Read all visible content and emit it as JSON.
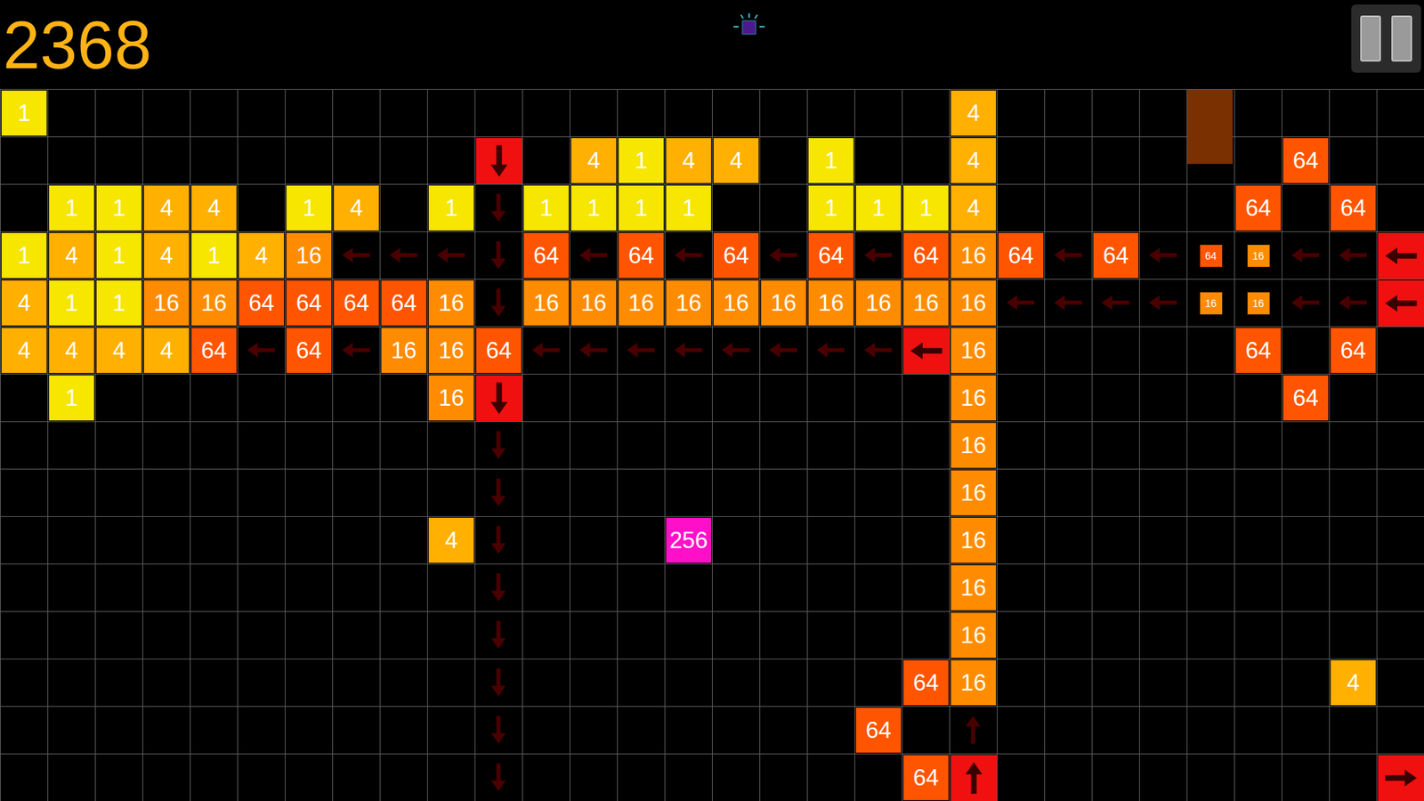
{
  "score": "2368",
  "board": {
    "columns": 30,
    "rows": [
      {
        "cells": [
          {
            "col": 0,
            "kind": "tile",
            "text": "1",
            "color": "#f7e600"
          },
          {
            "col": 20,
            "kind": "tile",
            "text": "4",
            "color": "#ffb000"
          },
          {
            "col": 25,
            "kind": "ghost",
            "color": "#7a3000"
          }
        ]
      },
      {
        "cells": [
          {
            "col": 10,
            "kind": "launcher",
            "direction": "down",
            "color": "#f01010"
          },
          {
            "col": 12,
            "kind": "tile",
            "text": "4",
            "color": "#ffb000"
          },
          {
            "col": 13,
            "kind": "tile",
            "text": "1",
            "color": "#f7e600"
          },
          {
            "col": 14,
            "kind": "tile",
            "text": "4",
            "color": "#ffb000"
          },
          {
            "col": 15,
            "kind": "tile",
            "text": "4",
            "color": "#ffb000"
          },
          {
            "col": 17,
            "kind": "tile",
            "text": "1",
            "color": "#f7e600"
          },
          {
            "col": 20,
            "kind": "tile",
            "text": "4",
            "color": "#ffb000"
          },
          {
            "col": 27,
            "kind": "tile",
            "text": "64",
            "color": "#ff5500"
          }
        ]
      },
      {
        "cells": [
          {
            "col": 1,
            "kind": "tile",
            "text": "1",
            "color": "#f7e600"
          },
          {
            "col": 2,
            "kind": "tile",
            "text": "1",
            "color": "#f7e600"
          },
          {
            "col": 3,
            "kind": "tile",
            "text": "4",
            "color": "#ffb000"
          },
          {
            "col": 4,
            "kind": "tile",
            "text": "4",
            "color": "#ffb000"
          },
          {
            "col": 6,
            "kind": "tile",
            "text": "1",
            "color": "#f7e600"
          },
          {
            "col": 7,
            "kind": "tile",
            "text": "4",
            "color": "#ffb000"
          },
          {
            "col": 9,
            "kind": "tile",
            "text": "1",
            "color": "#f7e600"
          },
          {
            "col": 10,
            "kind": "arrow",
            "direction": "down"
          },
          {
            "col": 11,
            "kind": "tile",
            "text": "1",
            "color": "#f7e600"
          },
          {
            "col": 12,
            "kind": "tile",
            "text": "1",
            "color": "#f7e600"
          },
          {
            "col": 13,
            "kind": "tile",
            "text": "1",
            "color": "#f7e600"
          },
          {
            "col": 14,
            "kind": "tile",
            "text": "1",
            "color": "#f7e600"
          },
          {
            "col": 17,
            "kind": "tile",
            "text": "1",
            "color": "#f7e600"
          },
          {
            "col": 18,
            "kind": "tile",
            "text": "1",
            "color": "#f7e600"
          },
          {
            "col": 19,
            "kind": "tile",
            "text": "1",
            "color": "#f7e600"
          },
          {
            "col": 20,
            "kind": "tile",
            "text": "4",
            "color": "#ffb000"
          },
          {
            "col": 26,
            "kind": "tile",
            "text": "64",
            "color": "#ff5500"
          },
          {
            "col": 28,
            "kind": "tile",
            "text": "64",
            "color": "#ff5500"
          }
        ]
      },
      {
        "cells": [
          {
            "col": 0,
            "kind": "tile",
            "text": "1",
            "color": "#f7e600"
          },
          {
            "col": 1,
            "kind": "tile",
            "text": "4",
            "color": "#ffb000"
          },
          {
            "col": 2,
            "kind": "tile",
            "text": "1",
            "color": "#f7e600"
          },
          {
            "col": 3,
            "kind": "tile",
            "text": "4",
            "color": "#ffb000"
          },
          {
            "col": 4,
            "kind": "tile",
            "text": "1",
            "color": "#f7e600"
          },
          {
            "col": 5,
            "kind": "tile",
            "text": "4",
            "color": "#ffb000"
          },
          {
            "col": 6,
            "kind": "tile",
            "text": "16",
            "color": "#ff8c00"
          },
          {
            "col": 7,
            "kind": "arrow",
            "direction": "left"
          },
          {
            "col": 8,
            "kind": "arrow",
            "direction": "left"
          },
          {
            "col": 9,
            "kind": "arrow",
            "direction": "left"
          },
          {
            "col": 10,
            "kind": "arrow",
            "direction": "down"
          },
          {
            "col": 11,
            "kind": "tile",
            "text": "64",
            "color": "#ff5500"
          },
          {
            "col": 12,
            "kind": "arrow",
            "direction": "left"
          },
          {
            "col": 13,
            "kind": "tile",
            "text": "64",
            "color": "#ff5500"
          },
          {
            "col": 14,
            "kind": "arrow",
            "direction": "left"
          },
          {
            "col": 15,
            "kind": "tile",
            "text": "64",
            "color": "#ff5500"
          },
          {
            "col": 16,
            "kind": "arrow",
            "direction": "left"
          },
          {
            "col": 17,
            "kind": "tile",
            "text": "64",
            "color": "#ff5500"
          },
          {
            "col": 18,
            "kind": "arrow",
            "direction": "left"
          },
          {
            "col": 19,
            "kind": "tile",
            "text": "64",
            "color": "#ff5500"
          },
          {
            "col": 20,
            "kind": "tile",
            "text": "16",
            "color": "#ff8c00"
          },
          {
            "col": 21,
            "kind": "tile",
            "text": "64",
            "color": "#ff5500"
          },
          {
            "col": 22,
            "kind": "arrow",
            "direction": "left"
          },
          {
            "col": 23,
            "kind": "tile",
            "text": "64",
            "color": "#ff5500"
          },
          {
            "col": 24,
            "kind": "arrow",
            "direction": "left"
          },
          {
            "col": 25,
            "kind": "small",
            "text": "64",
            "color": "#ff5500"
          },
          {
            "col": 26,
            "kind": "small",
            "text": "16",
            "color": "#ff8c00"
          },
          {
            "col": 27,
            "kind": "arrow",
            "direction": "left"
          },
          {
            "col": 28,
            "kind": "arrow",
            "direction": "left"
          },
          {
            "col": 29,
            "kind": "launcher",
            "direction": "left",
            "color": "#f01010"
          }
        ]
      },
      {
        "cells": [
          {
            "col": 0,
            "kind": "tile",
            "text": "4",
            "color": "#ffb000"
          },
          {
            "col": 1,
            "kind": "tile",
            "text": "1",
            "color": "#f7e600"
          },
          {
            "col": 2,
            "kind": "tile",
            "text": "1",
            "color": "#f7e600"
          },
          {
            "col": 3,
            "kind": "tile",
            "text": "16",
            "color": "#ff8c00"
          },
          {
            "col": 4,
            "kind": "tile",
            "text": "16",
            "color": "#ff8c00"
          },
          {
            "col": 5,
            "kind": "tile",
            "text": "64",
            "color": "#ff5500"
          },
          {
            "col": 6,
            "kind": "tile",
            "text": "64",
            "color": "#ff5500"
          },
          {
            "col": 7,
            "kind": "tile",
            "text": "64",
            "color": "#ff5500"
          },
          {
            "col": 8,
            "kind": "tile",
            "text": "64",
            "color": "#ff5500"
          },
          {
            "col": 9,
            "kind": "tile",
            "text": "16",
            "color": "#ff8c00"
          },
          {
            "col": 10,
            "kind": "arrow",
            "direction": "down"
          },
          {
            "col": 11,
            "kind": "tile",
            "text": "16",
            "color": "#ff8c00"
          },
          {
            "col": 12,
            "kind": "tile",
            "text": "16",
            "color": "#ff8c00"
          },
          {
            "col": 13,
            "kind": "tile",
            "text": "16",
            "color": "#ff8c00"
          },
          {
            "col": 14,
            "kind": "tile",
            "text": "16",
            "color": "#ff8c00"
          },
          {
            "col": 15,
            "kind": "tile",
            "text": "16",
            "color": "#ff8c00"
          },
          {
            "col": 16,
            "kind": "tile",
            "text": "16",
            "color": "#ff8c00"
          },
          {
            "col": 17,
            "kind": "tile",
            "text": "16",
            "color": "#ff8c00"
          },
          {
            "col": 18,
            "kind": "tile",
            "text": "16",
            "color": "#ff8c00"
          },
          {
            "col": 19,
            "kind": "tile",
            "text": "16",
            "color": "#ff8c00"
          },
          {
            "col": 20,
            "kind": "tile",
            "text": "16",
            "color": "#ff8c00"
          },
          {
            "col": 21,
            "kind": "arrow",
            "direction": "left"
          },
          {
            "col": 22,
            "kind": "arrow",
            "direction": "left"
          },
          {
            "col": 23,
            "kind": "arrow",
            "direction": "left"
          },
          {
            "col": 24,
            "kind": "arrow",
            "direction": "left"
          },
          {
            "col": 25,
            "kind": "small",
            "text": "16",
            "color": "#ff8c00"
          },
          {
            "col": 26,
            "kind": "small",
            "text": "16",
            "color": "#ff8c00"
          },
          {
            "col": 27,
            "kind": "arrow",
            "direction": "left"
          },
          {
            "col": 28,
            "kind": "arrow",
            "direction": "left"
          },
          {
            "col": 29,
            "kind": "launcher",
            "direction": "left",
            "color": "#f01010"
          }
        ]
      },
      {
        "cells": [
          {
            "col": 0,
            "kind": "tile",
            "text": "4",
            "color": "#ffb000"
          },
          {
            "col": 1,
            "kind": "tile",
            "text": "4",
            "color": "#ffb000"
          },
          {
            "col": 2,
            "kind": "tile",
            "text": "4",
            "color": "#ffb000"
          },
          {
            "col": 3,
            "kind": "tile",
            "text": "4",
            "color": "#ffb000"
          },
          {
            "col": 4,
            "kind": "tile",
            "text": "64",
            "color": "#ff5500"
          },
          {
            "col": 5,
            "kind": "arrow",
            "direction": "left"
          },
          {
            "col": 6,
            "kind": "tile",
            "text": "64",
            "color": "#ff5500"
          },
          {
            "col": 7,
            "kind": "arrow",
            "direction": "left"
          },
          {
            "col": 8,
            "kind": "tile",
            "text": "16",
            "color": "#ff8c00"
          },
          {
            "col": 9,
            "kind": "tile",
            "text": "16",
            "color": "#ff8c00"
          },
          {
            "col": 10,
            "kind": "tile",
            "text": "64",
            "color": "#ff5500"
          },
          {
            "col": 11,
            "kind": "arrow",
            "direction": "left"
          },
          {
            "col": 12,
            "kind": "arrow",
            "direction": "left"
          },
          {
            "col": 13,
            "kind": "arrow",
            "direction": "left"
          },
          {
            "col": 14,
            "kind": "arrow",
            "direction": "left"
          },
          {
            "col": 15,
            "kind": "arrow",
            "direction": "left"
          },
          {
            "col": 16,
            "kind": "arrow",
            "direction": "left"
          },
          {
            "col": 17,
            "kind": "arrow",
            "direction": "left"
          },
          {
            "col": 18,
            "kind": "arrow",
            "direction": "left"
          },
          {
            "col": 19,
            "kind": "launcher",
            "direction": "left",
            "color": "#f01010"
          },
          {
            "col": 20,
            "kind": "tile",
            "text": "16",
            "color": "#ff8c00"
          },
          {
            "col": 26,
            "kind": "tile",
            "text": "64",
            "color": "#ff5500"
          },
          {
            "col": 28,
            "kind": "tile",
            "text": "64",
            "color": "#ff5500"
          }
        ]
      },
      {
        "cells": [
          {
            "col": 1,
            "kind": "tile",
            "text": "1",
            "color": "#f7e600"
          },
          {
            "col": 9,
            "kind": "tile",
            "text": "16",
            "color": "#ff8c00"
          },
          {
            "col": 10,
            "kind": "launcher",
            "direction": "down",
            "color": "#f01010"
          },
          {
            "col": 20,
            "kind": "tile",
            "text": "16",
            "color": "#ff8c00"
          },
          {
            "col": 27,
            "kind": "tile",
            "text": "64",
            "color": "#ff5500"
          }
        ]
      },
      {
        "cells": [
          {
            "col": 10,
            "kind": "arrow",
            "direction": "down"
          },
          {
            "col": 20,
            "kind": "tile",
            "text": "16",
            "color": "#ff8c00"
          }
        ]
      },
      {
        "cells": [
          {
            "col": 10,
            "kind": "arrow",
            "direction": "down"
          },
          {
            "col": 20,
            "kind": "tile",
            "text": "16",
            "color": "#ff8c00"
          }
        ]
      },
      {
        "cells": [
          {
            "col": 9,
            "kind": "tile",
            "text": "4",
            "color": "#ffb000"
          },
          {
            "col": 10,
            "kind": "arrow",
            "direction": "down"
          },
          {
            "col": 14,
            "kind": "tile",
            "text": "256",
            "color": "#ff10c8"
          },
          {
            "col": 20,
            "kind": "tile",
            "text": "16",
            "color": "#ff8c00"
          }
        ]
      },
      {
        "cells": [
          {
            "col": 10,
            "kind": "arrow",
            "direction": "down"
          },
          {
            "col": 20,
            "kind": "tile",
            "text": "16",
            "color": "#ff8c00"
          }
        ]
      },
      {
        "cells": [
          {
            "col": 10,
            "kind": "arrow",
            "direction": "down"
          },
          {
            "col": 20,
            "kind": "tile",
            "text": "16",
            "color": "#ff8c00"
          }
        ]
      },
      {
        "cells": [
          {
            "col": 10,
            "kind": "arrow",
            "direction": "down"
          },
          {
            "col": 19,
            "kind": "tile",
            "text": "64",
            "color": "#ff5500"
          },
          {
            "col": 20,
            "kind": "tile",
            "text": "16",
            "color": "#ff8c00"
          },
          {
            "col": 28,
            "kind": "tile",
            "text": "4",
            "color": "#ffb000"
          }
        ]
      },
      {
        "cells": [
          {
            "col": 10,
            "kind": "arrow",
            "direction": "down"
          },
          {
            "col": 18,
            "kind": "tile",
            "text": "64",
            "color": "#ff5500"
          },
          {
            "col": 20,
            "kind": "arrow",
            "direction": "up"
          }
        ]
      },
      {
        "cells": [
          {
            "col": 10,
            "kind": "arrow",
            "direction": "down"
          },
          {
            "col": 19,
            "kind": "tile",
            "text": "64",
            "color": "#ff5500"
          },
          {
            "col": 20,
            "kind": "launcher",
            "direction": "up",
            "color": "#f01010"
          },
          {
            "col": 29,
            "kind": "launcher",
            "direction": "right",
            "color": "#f01010"
          }
        ]
      }
    ]
  }
}
